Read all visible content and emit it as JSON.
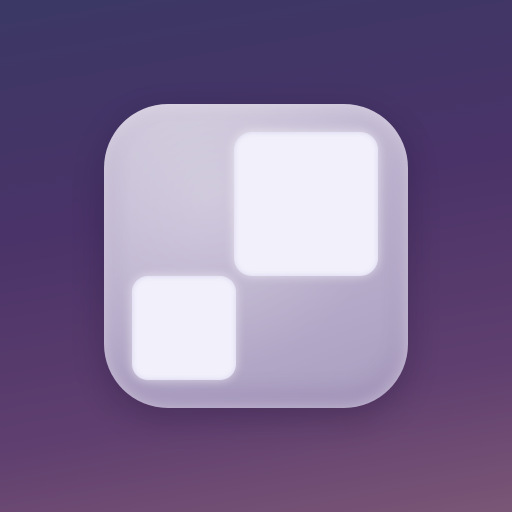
{
  "app_icon": {
    "icon": "two-squares-icon",
    "colors": {
      "background_top": "#3b3865",
      "background_bottom": "#7a5676",
      "tile": "#bdb3cf",
      "square": "#f2f1fb"
    }
  }
}
